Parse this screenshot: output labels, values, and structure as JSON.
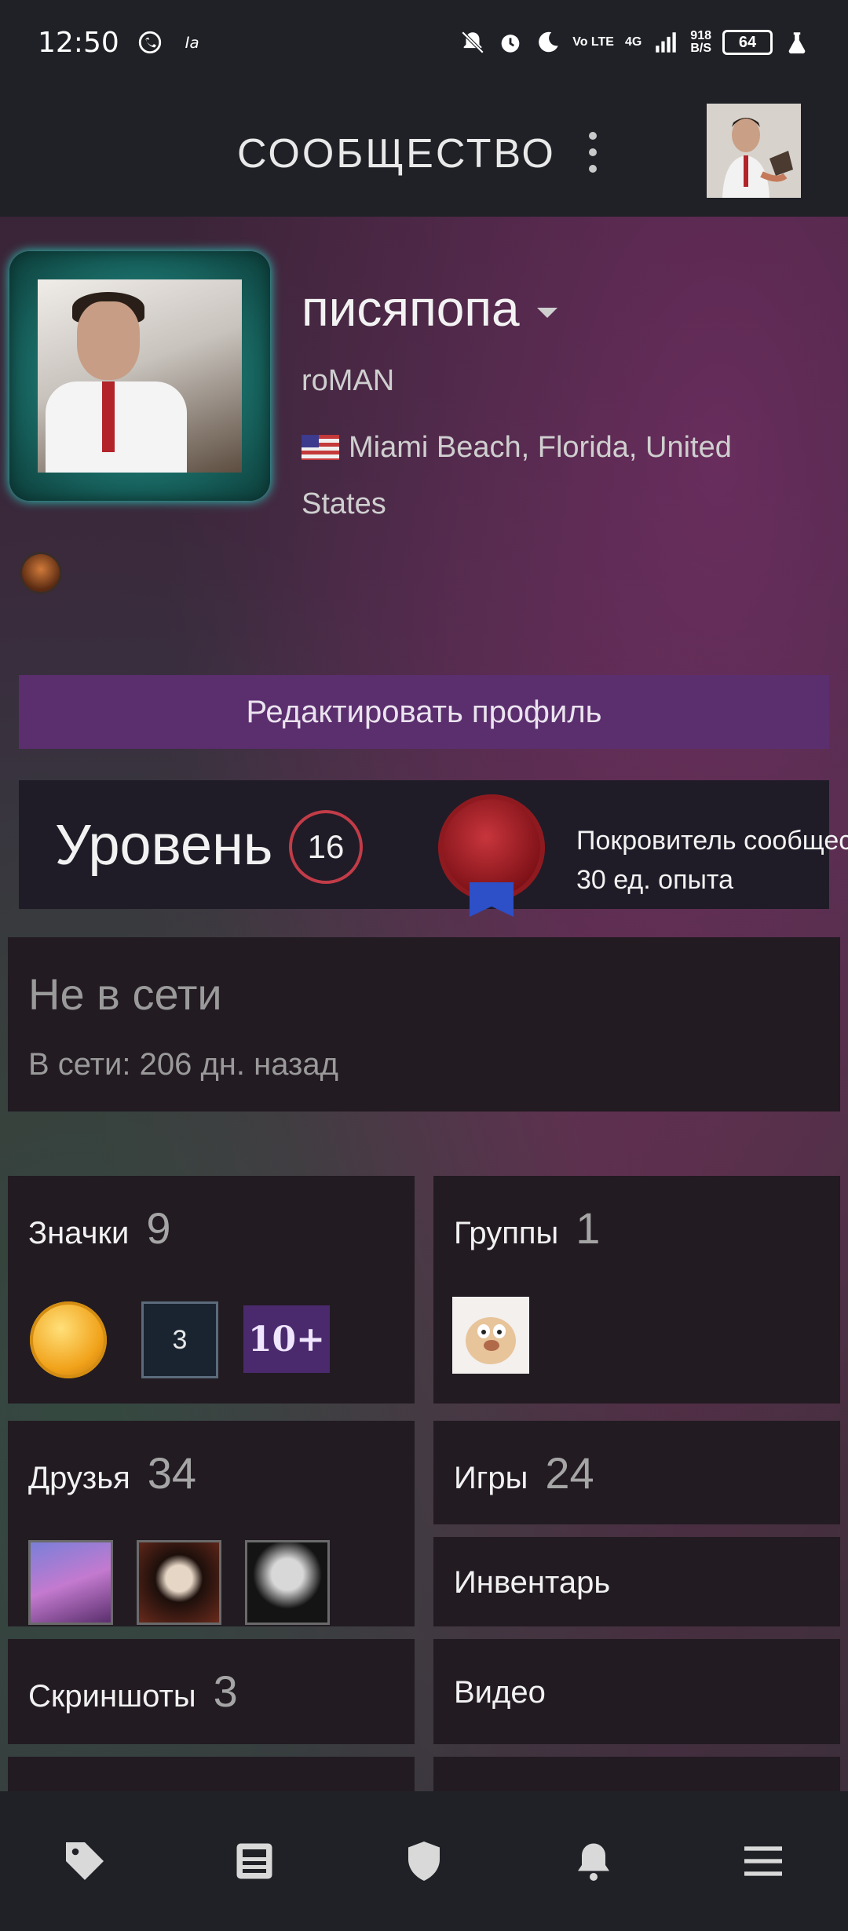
{
  "status_bar": {
    "time": "12:50",
    "network_speed": "918",
    "network_unit": "B/S",
    "battery": "64",
    "volte": "Vo LTE",
    "net_type": "4G"
  },
  "header": {
    "title": "СООБЩЕСТВО"
  },
  "profile": {
    "username": "писяпопа",
    "real_name": "roMAN",
    "location": "Miami Beach, Florida, United States",
    "edit_button": "Редактировать профиль"
  },
  "level": {
    "label": "Уровень",
    "value": "16",
    "xp_title": "Покровитель сообщества",
    "xp_sub": "30 ед. опыта"
  },
  "status": {
    "main": "Не в сети",
    "sub": "В сети: 206 дн. назад"
  },
  "tiles": {
    "badges": {
      "label": "Значки",
      "count": "9",
      "badge_3_text": "3",
      "badge_10_text": "10+"
    },
    "groups": {
      "label": "Группы",
      "count": "1"
    },
    "friends": {
      "label": "Друзья",
      "count": "34"
    },
    "games": {
      "label": "Игры",
      "count": "24"
    },
    "inventory": {
      "label": "Инвентарь"
    },
    "screenshots": {
      "label": "Скриншоты",
      "count": "3"
    },
    "videos": {
      "label": "Видео"
    }
  },
  "bottom_nav": {
    "items": [
      "tag-icon",
      "news-icon",
      "shield-icon",
      "bell-icon",
      "menu-icon"
    ]
  },
  "colors": {
    "accent_purple": "#5b2e6e",
    "level_ring": "#c23c48",
    "bar_bg": "#1f2126"
  }
}
